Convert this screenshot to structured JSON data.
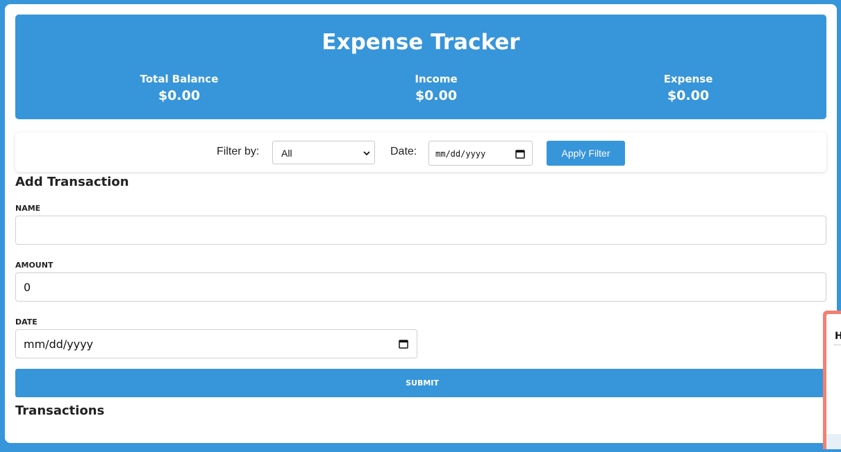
{
  "app": {
    "title": "Expense Tracker"
  },
  "summary": {
    "balance_label": "Total Balance",
    "balance_value": "$0.00",
    "income_label": "Income",
    "income_value": "$0.00",
    "expense_label": "Expense",
    "expense_value": "$0.00"
  },
  "filter": {
    "filter_label": "Filter by:",
    "filter_value": "All",
    "date_label": "Date:",
    "date_placeholder": "mm/dd/yyyy",
    "apply_label": "Apply Filter"
  },
  "add_transaction": {
    "title": "Add Transaction",
    "name_label": "NAME",
    "name_value": "",
    "amount_label": "AMOUNT",
    "amount_value": "0",
    "date_label": "DATE",
    "date_placeholder": "mm/dd/yyyy",
    "submit_label": "SUBMIT"
  },
  "transactions": {
    "title": "Transactions"
  },
  "popup": {
    "partial_text": "H"
  },
  "colors": {
    "accent": "#3795da",
    "popup_border": "#f38070"
  }
}
